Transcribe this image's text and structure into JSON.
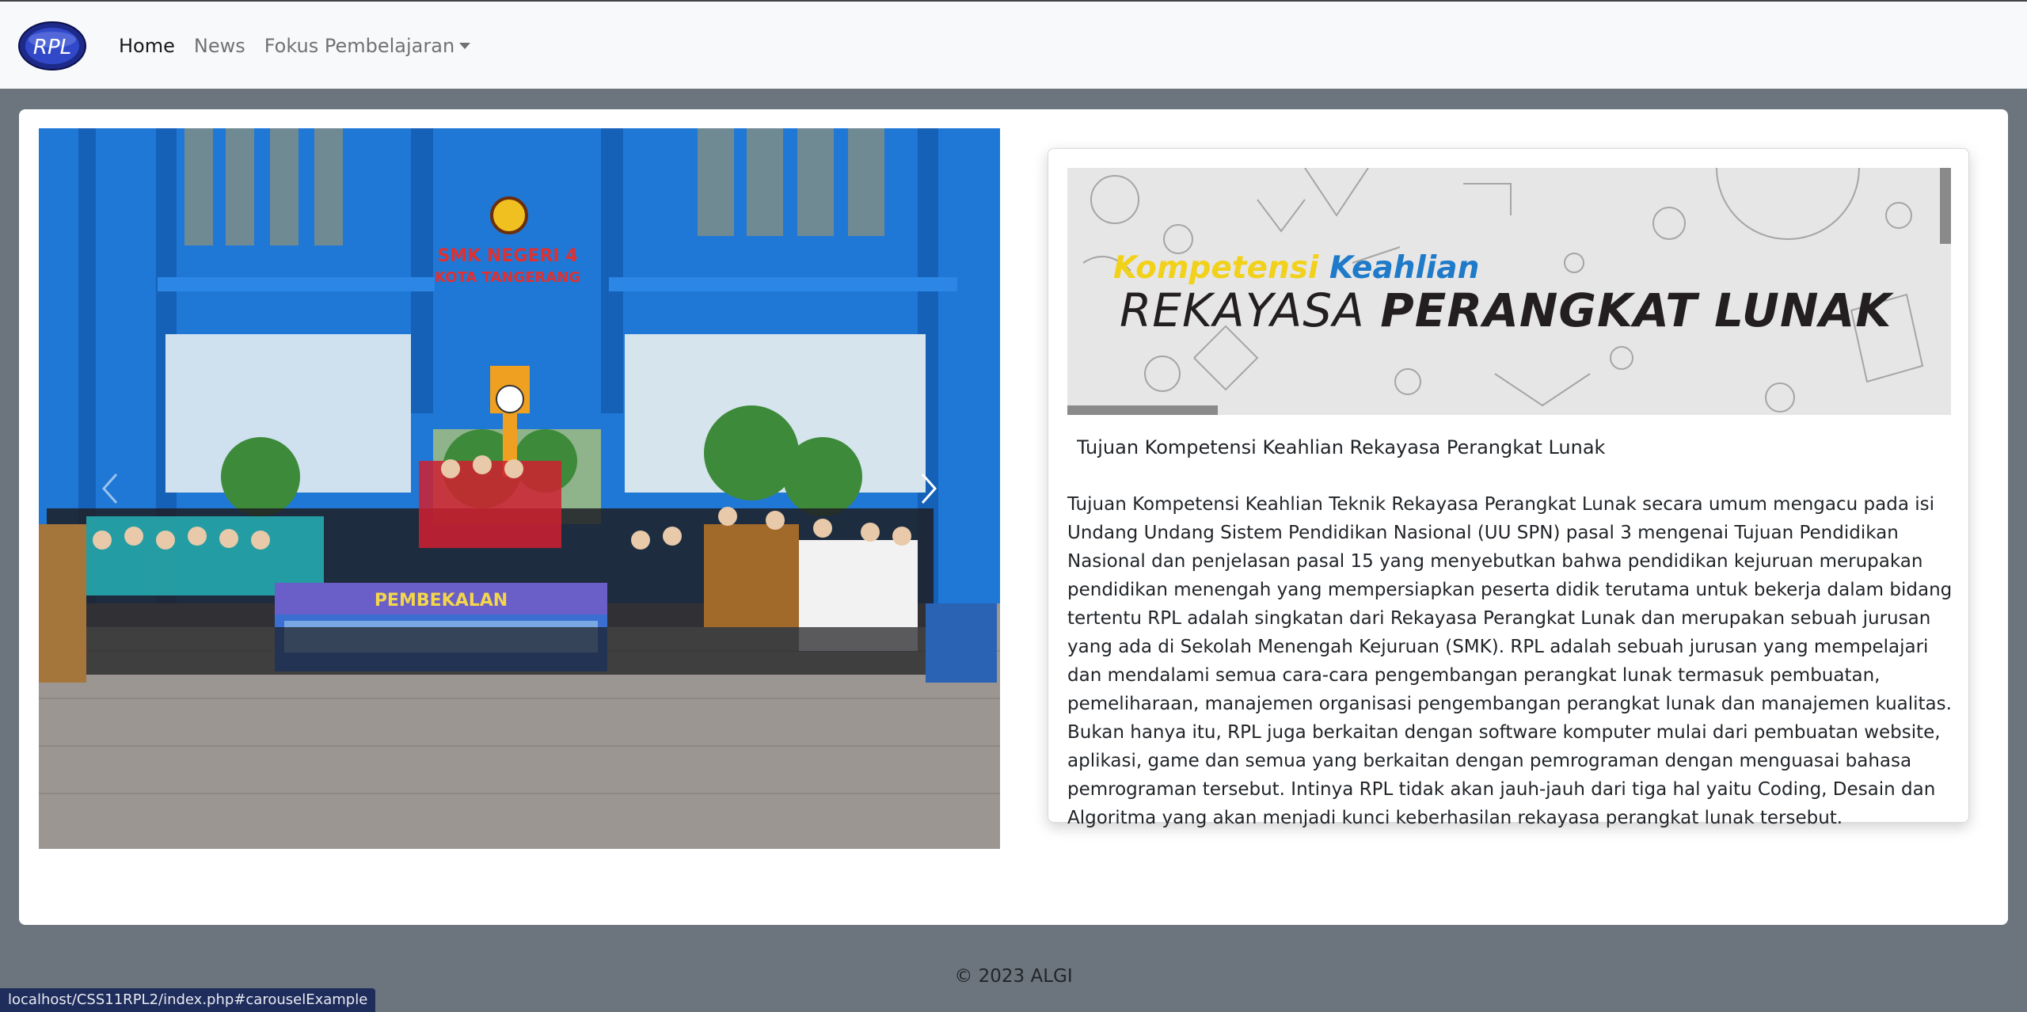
{
  "navbar": {
    "logo_text": "RPL",
    "links": [
      {
        "label": "Home",
        "active": true
      },
      {
        "label": "News",
        "active": false
      },
      {
        "label": "Fokus Pembelajaran",
        "dropdown": true
      }
    ]
  },
  "carousel": {
    "building_sign_line1": "SMK NEGERI 4",
    "building_sign_line2": "KOTA TANGERANG",
    "banner_heading": "PEMBEKALAN",
    "prev_icon": "chevron-left-icon",
    "next_icon": "chevron-right-icon"
  },
  "card": {
    "banner": {
      "line1_part1": "Kompetensi",
      "line1_part2": "Keahlian",
      "line2_part1": "REKAYASA",
      "line2_part2": "PERANGKAT LUNAK"
    },
    "title": "Tujuan Kompetensi Keahlian Rekayasa Perangkat Lunak",
    "text": "Tujuan Kompetensi Keahlian Teknik Rekayasa Perangkat Lunak secara umum mengacu pada isi Undang Undang Sistem Pendidikan Nasional (UU SPN) pasal 3 mengenai Tujuan Pendidikan Nasional dan penjelasan pasal 15 yang menyebutkan bahwa pendidikan kejuruan merupakan pendidikan menengah yang mempersiapkan peserta didik terutama untuk bekerja dalam bidang tertentu RPL adalah singkatan dari Rekayasa Perangkat Lunak dan merupakan sebuah jurusan yang ada di Sekolah Menengah Kejuruan (SMK). RPL adalah sebuah jurusan yang mempelajari dan mendalami semua cara-cara pengembangan perangkat lunak termasuk pembuatan, pemeliharaan, manajemen organisasi pengembangan perangkat lunak dan manajemen kualitas. Bukan hanya itu, RPL juga berkaitan dengan software komputer mulai dari pembuatan website, aplikasi, game dan semua yang berkaitan dengan pemrograman dengan menguasai bahasa pemrograman tersebut. Intinya RPL tidak akan jauh-jauh dari tiga hal yaitu Coding, Desain dan Algoritma yang akan menjadi kunci keberhasilan rekayasa perangkat lunak tersebut."
  },
  "footer": {
    "copyright": "© 2023 ALGI"
  },
  "status_bar": {
    "url": "localhost/CSS11RPL2/index.php#carouselExample"
  }
}
